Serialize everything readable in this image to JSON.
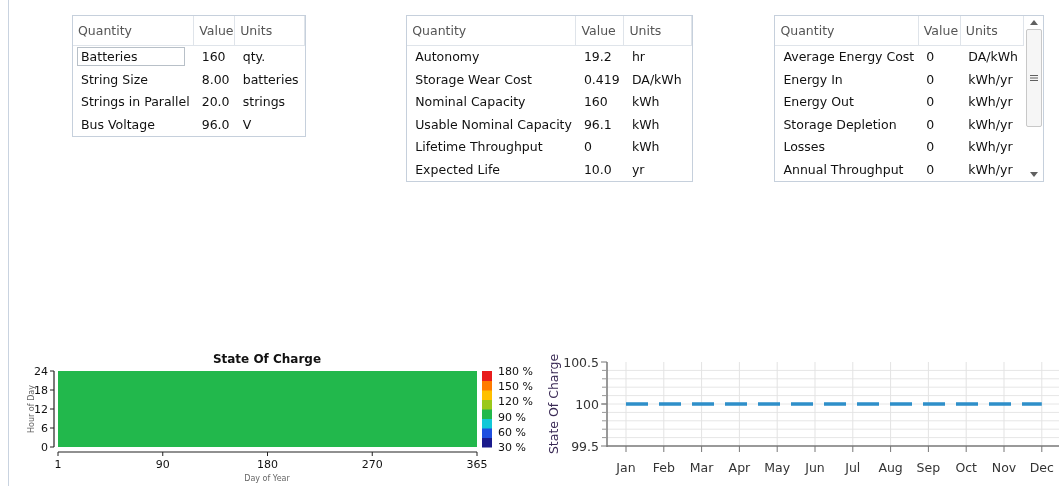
{
  "tables": [
    {
      "scrollable": false,
      "columns": [
        "Quantity",
        "Value",
        "Units"
      ],
      "rows": [
        {
          "quantity": "Batteries",
          "value": "160",
          "units": "qty.",
          "selected": true
        },
        {
          "quantity": "String Size",
          "value": "8.00",
          "units": "batteries",
          "selected": false
        },
        {
          "quantity": "Strings in Parallel",
          "value": "20.0",
          "units": "strings",
          "selected": false
        },
        {
          "quantity": "Bus Voltage",
          "value": "96.0",
          "units": "V",
          "selected": false
        }
      ]
    },
    {
      "scrollable": false,
      "columns": [
        "Quantity",
        "Value",
        "Units"
      ],
      "rows": [
        {
          "quantity": "Autonomy",
          "value": "19.2",
          "units": "hr",
          "selected": false
        },
        {
          "quantity": "Storage Wear Cost",
          "value": "0.419",
          "units": "DA/kWh",
          "selected": false
        },
        {
          "quantity": "Nominal Capacity",
          "value": "160",
          "units": "kWh",
          "selected": false
        },
        {
          "quantity": "Usable Nominal Capacity",
          "value": "96.1",
          "units": "kWh",
          "selected": false
        },
        {
          "quantity": "Lifetime Throughput",
          "value": "0",
          "units": "kWh",
          "selected": false
        },
        {
          "quantity": "Expected Life",
          "value": "10.0",
          "units": "yr",
          "selected": false
        }
      ]
    },
    {
      "scrollable": true,
      "columns": [
        "Quantity",
        "Value",
        "Units"
      ],
      "rows": [
        {
          "quantity": "Average Energy Cost",
          "value": "0",
          "units": "DA/kWh",
          "selected": false
        },
        {
          "quantity": "Energy In",
          "value": "0",
          "units": "kWh/yr",
          "selected": false
        },
        {
          "quantity": "Energy Out",
          "value": "0",
          "units": "kWh/yr",
          "selected": false
        },
        {
          "quantity": "Storage Depletion",
          "value": "0",
          "units": "kWh/yr",
          "selected": false
        },
        {
          "quantity": "Losses",
          "value": "0",
          "units": "kWh/yr",
          "selected": false
        },
        {
          "quantity": "Annual Throughput",
          "value": "0",
          "units": "kWh/yr",
          "selected": false
        }
      ]
    }
  ],
  "heatmap": {
    "title": "State Of Charge",
    "xlabel": "Day of Year",
    "ylabel": "Hour of Day",
    "xticks": [
      "1",
      "90",
      "180",
      "270",
      "365"
    ],
    "yticks": [
      "24",
      "18",
      "12",
      "6",
      "0"
    ],
    "colorbar_ticks": [
      "180 %",
      "150 %",
      "120 %",
      "90 %",
      "60 %",
      "30 %"
    ],
    "color": "#22b84c"
  },
  "line_chart": {
    "chart_data": {
      "type": "line",
      "ylabel": "State Of Charge",
      "categories": [
        "Jan",
        "Feb",
        "Mar",
        "Apr",
        "May",
        "Jun",
        "Jul",
        "Aug",
        "Sep",
        "Oct",
        "Nov",
        "Dec"
      ],
      "grid": true,
      "series": [
        {
          "color": "#2e8fc9",
          "line_style": "dashed",
          "values": [
            100,
            100,
            100,
            100,
            100,
            100,
            100,
            100,
            100,
            100,
            100,
            100
          ]
        }
      ],
      "ylim": [
        99.5,
        100.5
      ],
      "yticks": [
        99.5,
        100,
        100.5
      ]
    }
  }
}
